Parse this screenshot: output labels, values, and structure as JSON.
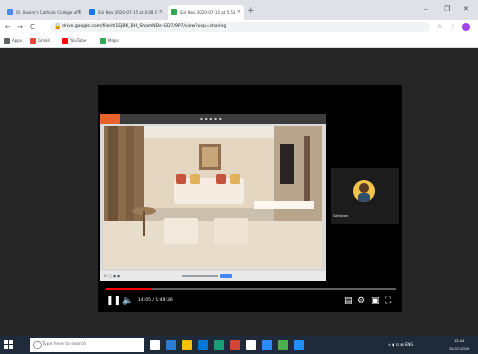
{
  "browser": {
    "tabs": [
      {
        "label": "St. Xavier's Catholic College of E",
        "favicon_color": "#4c8bf5",
        "active": false
      },
      {
        "label": "Siri Nov 2020-07-15 at 0.08 C",
        "favicon_color": "#1a73e8",
        "active": false
      },
      {
        "label": "Siri Nov 2020-07-15 at 5.53",
        "favicon_color": "#34a853",
        "active": true
      }
    ],
    "new_tab_glyph": "+",
    "tab_close_glyph": "×",
    "window_controls": {
      "minimize": "–",
      "maximize": "❐",
      "close": "✕"
    }
  },
  "toolbar": {
    "back_glyph": "←",
    "forward_glyph": "→",
    "reload_glyph": "C",
    "lock_glyph": "🔒",
    "url": "drive.google.com/file/d/1EJBK_BH_ShamNDe-GD7/9P7/view?usp=sharing",
    "star_glyph": "☆",
    "extensions_glyph": "⋮",
    "profile_color": "#a142f4"
  },
  "bookmarks": [
    {
      "label": "Apps",
      "icon_color": "#5f6368"
    },
    {
      "label": "Gmail",
      "icon_color": "#ea4335"
    },
    {
      "label": "YouTube",
      "icon_color": "#ff0000"
    },
    {
      "label": "Maps",
      "icon_color": "#34a853"
    }
  ],
  "player": {
    "timecode": "14:05 / 1:49:36",
    "progress_fraction": 0.16,
    "play_pause_glyph": "❚❚",
    "volume_glyph": "🔈",
    "settings_glyph": "⚙",
    "miniplayer_glyph": "▣",
    "fullscreen_glyph": "⛶",
    "subtitles_glyph": "▤",
    "participant_name": "Sathiyan",
    "shared_footer_text": "⊞  ◯  ◼  ◼"
  },
  "taskbar": {
    "search_placeholder": "Type here to search",
    "search_glyph": "◯",
    "tray_text": "∧  ◖ ⊡ ⊠ ENG",
    "time": "12:44",
    "date": "15-07-2020",
    "pinned_icon_colors": [
      "#ffffff",
      "#2d7dd2",
      "#f4c20d",
      "#0078d4",
      "#1b9e77",
      "#d44638",
      "#ffffff",
      "#2c8cff",
      "#4caf50",
      "#1e90ff"
    ]
  },
  "colors": {
    "viewer_bg": "#262626",
    "taskbar_bg": "#1f2b3a",
    "progress_fill": "#ff0000"
  }
}
